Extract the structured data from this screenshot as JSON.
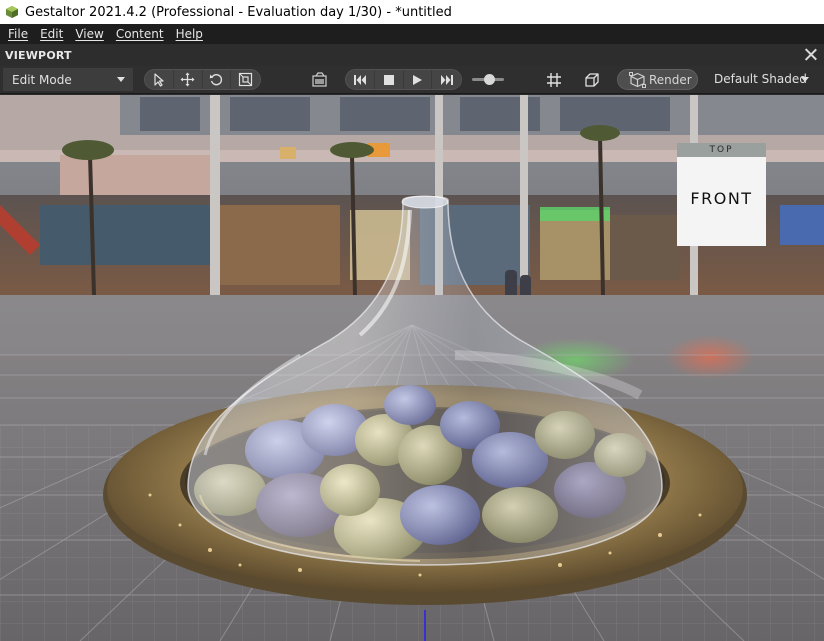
{
  "window": {
    "title": "Gestaltor 2021.4.2 (Professional - Evaluation day 1/30) - *untitled",
    "app_icon": "gestaltor-logo-icon"
  },
  "menu": {
    "items": [
      {
        "label": "File"
      },
      {
        "label": "Edit"
      },
      {
        "label": "View"
      },
      {
        "label": "Content"
      },
      {
        "label": "Help"
      }
    ]
  },
  "viewport_panel": {
    "title": "VIEWPORT",
    "close_icon": "close-icon"
  },
  "toolbar": {
    "mode_select": {
      "value": "Edit Mode"
    },
    "transform_tools": [
      "select-arrow-icon",
      "move-icon",
      "rotate-icon",
      "scale-icon"
    ],
    "camera_icon": "camera-bookmark-icon",
    "playback": [
      "skip-back-icon",
      "stop-icon",
      "play-icon",
      "skip-forward-icon"
    ],
    "grid_icon": "grid-icon",
    "cube_icon": "bounding-box-icon",
    "render_label": "Render",
    "shading_select": {
      "value": "Default Shaded"
    }
  },
  "viewcube": {
    "face_label": "FRONT",
    "top_label": "TOP"
  },
  "colors": {
    "titlebar_bg": "#ffffff",
    "menubar_bg": "#1e1e1e",
    "toolbar_bg": "#2f2f2f",
    "accent_axis": "#3a2fd0"
  }
}
